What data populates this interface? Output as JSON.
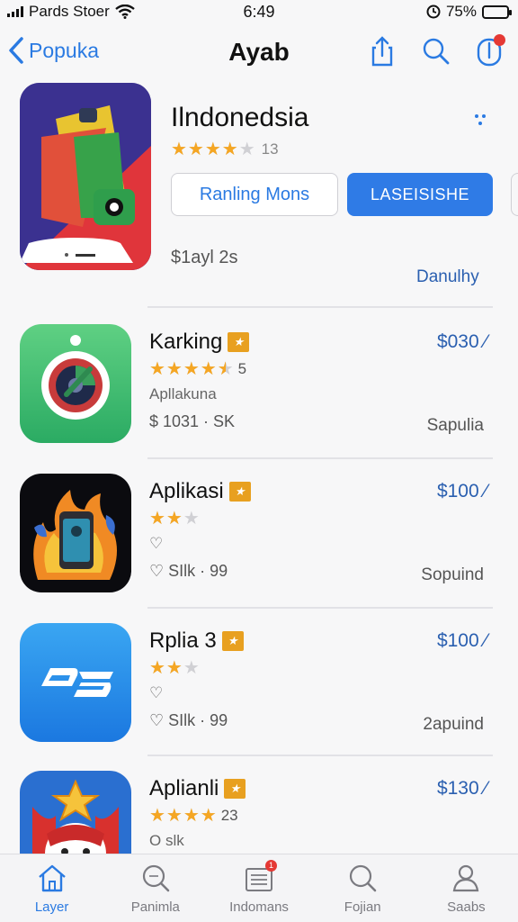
{
  "status_bar": {
    "carrier": "Pards Stoer",
    "time": "6:49",
    "battery": "75%",
    "battery_level": 0.75
  },
  "nav": {
    "back_label": "Popuka",
    "title": "Ayab"
  },
  "featured": {
    "title": "Ilndonedsia",
    "rating": 4,
    "rating_count": "13",
    "button_secondary": "Ranling Mons",
    "button_primary": "LASEISISHE",
    "price": "$1ayl 2s",
    "action": "Danulhy"
  },
  "apps": [
    {
      "name": "Karking",
      "rating": 4.5,
      "rating_count": "5",
      "category": "Apllakuna",
      "size": "$ 1031 · SK",
      "price": "$030 ⁄",
      "action": "Sapulia"
    },
    {
      "name": "Aplikasi",
      "rating": 2,
      "rating_count": "",
      "category": "♡",
      "size": "♡ SIlk · 99",
      "price": "$100 ⁄",
      "action": "Sopuind"
    },
    {
      "name": "Rplia 3",
      "rating": 2,
      "rating_count": "",
      "category": "♡",
      "size": "♡ SIlk · 99",
      "price": "$100 ⁄",
      "action": "2apuind"
    },
    {
      "name": "Aplianli",
      "rating": 4,
      "rating_count": "23",
      "category": "O slk",
      "size": "",
      "price": "$130 ⁄",
      "action": ""
    }
  ],
  "tabs": [
    {
      "label": "Layer",
      "icon": "home-icon",
      "active": true
    },
    {
      "label": "Panimla",
      "icon": "search-icon"
    },
    {
      "label": "Indomans",
      "icon": "list-icon",
      "badge": "1"
    },
    {
      "label": "Fojian",
      "icon": "search-icon"
    },
    {
      "label": "Saabs",
      "icon": "person-icon"
    }
  ],
  "colors": {
    "accent": "#2a7ae2",
    "star": "#f5a623",
    "editor_badge": "#e8a020"
  }
}
